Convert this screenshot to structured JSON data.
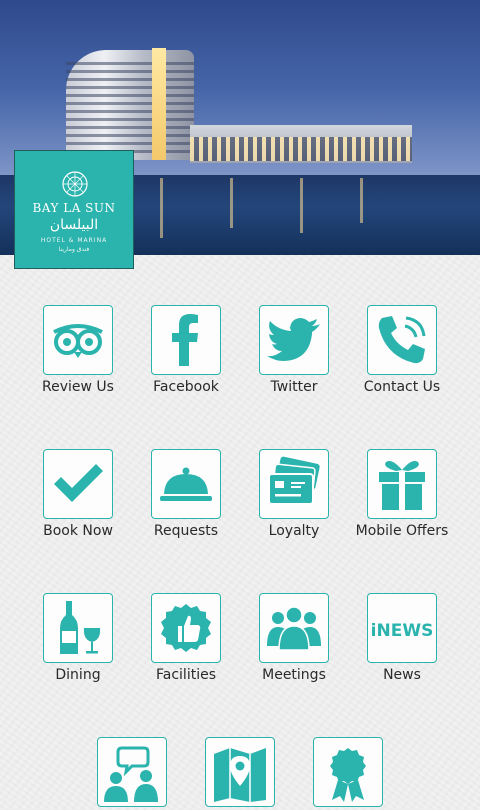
{
  "brand": {
    "name_en": "BAY LA SUN",
    "name_ar": "البيلسان",
    "subtitle": "HOTEL & MARINA",
    "subtitle_ar": "فندق ومارينا"
  },
  "accent_color": "#2bb3ad",
  "tiles": [
    {
      "label": "Review Us",
      "icon": "tripadvisor-owl-icon"
    },
    {
      "label": "Facebook",
      "icon": "facebook-icon"
    },
    {
      "label": "Twitter",
      "icon": "twitter-bird-icon"
    },
    {
      "label": "Contact Us",
      "icon": "phone-icon"
    },
    {
      "label": "Book Now",
      "icon": "checkmark-icon"
    },
    {
      "label": "Requests",
      "icon": "room-service-cloche-icon"
    },
    {
      "label": "Loyalty",
      "icon": "credit-cards-icon"
    },
    {
      "label": "Mobile Offers",
      "icon": "gift-box-icon"
    },
    {
      "label": "Dining",
      "icon": "wine-bottle-glass-icon"
    },
    {
      "label": "Facilities",
      "icon": "thumbs-up-badge-icon"
    },
    {
      "label": "Meetings",
      "icon": "people-group-icon"
    },
    {
      "label": "News",
      "icon": "news-icon",
      "icon_text": "iNEWS"
    },
    {
      "label": "",
      "icon": "chat-people-icon"
    },
    {
      "label": "",
      "icon": "map-pin-icon"
    },
    {
      "label": "",
      "icon": "award-ribbon-icon"
    }
  ]
}
